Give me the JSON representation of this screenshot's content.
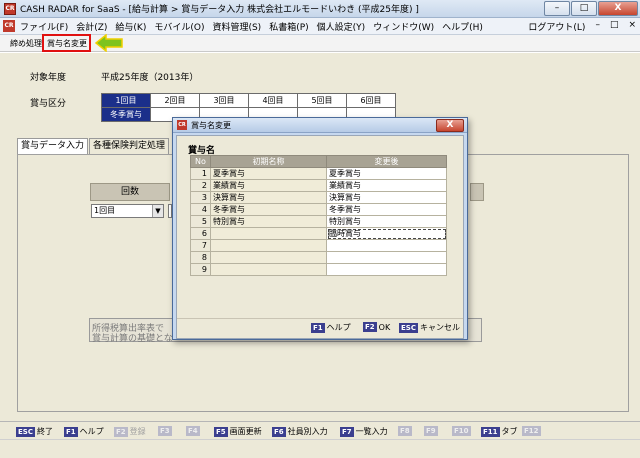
{
  "titlebar": {
    "icon": "CR",
    "title": "CASH RADAR for SaaS - [給与計算 > 賞与データ入力 株式会社エルモードいわき (平成25年度) ]",
    "minimize": "–",
    "maximize": "□",
    "close": "X"
  },
  "menubar": {
    "items": [
      "ファイル(F)",
      "会計(Z)",
      "給与(K)",
      "モバイル(O)",
      "資料管理(S)",
      "私書箱(P)",
      "個人設定(Y)",
      "ウィンドウ(W)",
      "ヘルプ(H)"
    ],
    "logout": "ログアウト(L)",
    "controls": [
      "–",
      "□",
      "×"
    ]
  },
  "submenu": {
    "items": [
      "締め処理",
      "賞与名変更"
    ]
  },
  "main": {
    "fiscal_year_label": "対象年度",
    "fiscal_year_value": "平成25年度（2013年）",
    "bonus_category_label": "賞与区分",
    "rounds": [
      "1回目",
      "2回目",
      "3回目",
      "4回目",
      "5回目",
      "6回目"
    ],
    "selected_bonus": "冬季賞与",
    "tabs": [
      "賞与データ入力",
      "各種保険判定処理"
    ],
    "count_header": "回数",
    "count_value": "1回目",
    "note_line1": "所得税算出率表で",
    "note_line2": "賞与計算の基礎とな"
  },
  "statusbar": {
    "keys": [
      {
        "key": "ESC",
        "label": "終了",
        "enabled": true
      },
      {
        "key": "F1",
        "label": "ヘルプ",
        "enabled": true
      },
      {
        "key": "F2",
        "label": "登録",
        "enabled": false
      },
      {
        "key": "F3",
        "label": "",
        "enabled": false
      },
      {
        "key": "F4",
        "label": "",
        "enabled": false
      },
      {
        "key": "F5",
        "label": "画面更新",
        "enabled": true
      },
      {
        "key": "F6",
        "label": "社員別入力",
        "enabled": true
      },
      {
        "key": "F7",
        "label": "一覧入力",
        "enabled": true
      },
      {
        "key": "F8",
        "label": "",
        "enabled": false
      },
      {
        "key": "F9",
        "label": "",
        "enabled": false
      },
      {
        "key": "F10",
        "label": "",
        "enabled": false
      },
      {
        "key": "F11",
        "label": "タブ",
        "enabled": true
      },
      {
        "key": "F12",
        "label": "",
        "enabled": false
      }
    ]
  },
  "dialog": {
    "title": "賞与名変更",
    "close": "X",
    "heading": "賞与名",
    "columns": [
      "No",
      "初期名称",
      "変更後"
    ],
    "rows": [
      {
        "no": "1",
        "initial": "夏季賞与",
        "changed": "夏季賞与"
      },
      {
        "no": "2",
        "initial": "業績賞与",
        "changed": "業績賞与"
      },
      {
        "no": "3",
        "initial": "決算賞与",
        "changed": "決算賞与"
      },
      {
        "no": "4",
        "initial": "冬季賞与",
        "changed": "冬季賞与"
      },
      {
        "no": "5",
        "initial": "特別賞与",
        "changed": "特別賞与"
      },
      {
        "no": "6",
        "initial": "",
        "changed": "臨時賞与"
      },
      {
        "no": "7",
        "initial": "",
        "changed": ""
      },
      {
        "no": "8",
        "initial": "",
        "changed": ""
      },
      {
        "no": "9",
        "initial": "",
        "changed": ""
      }
    ],
    "footer": [
      {
        "key": "F1",
        "label": "ヘルプ"
      },
      {
        "key": "F2",
        "label": "OK"
      },
      {
        "key": "ESC",
        "label": "キャンセル"
      }
    ]
  },
  "colors": {
    "accent_navy": "#1b2f8a",
    "fkey_bg": "#3b3f8f",
    "highlight_red": "#e01010",
    "arrow_green": "#7ec31e",
    "arrow_outline": "#f0d000"
  }
}
